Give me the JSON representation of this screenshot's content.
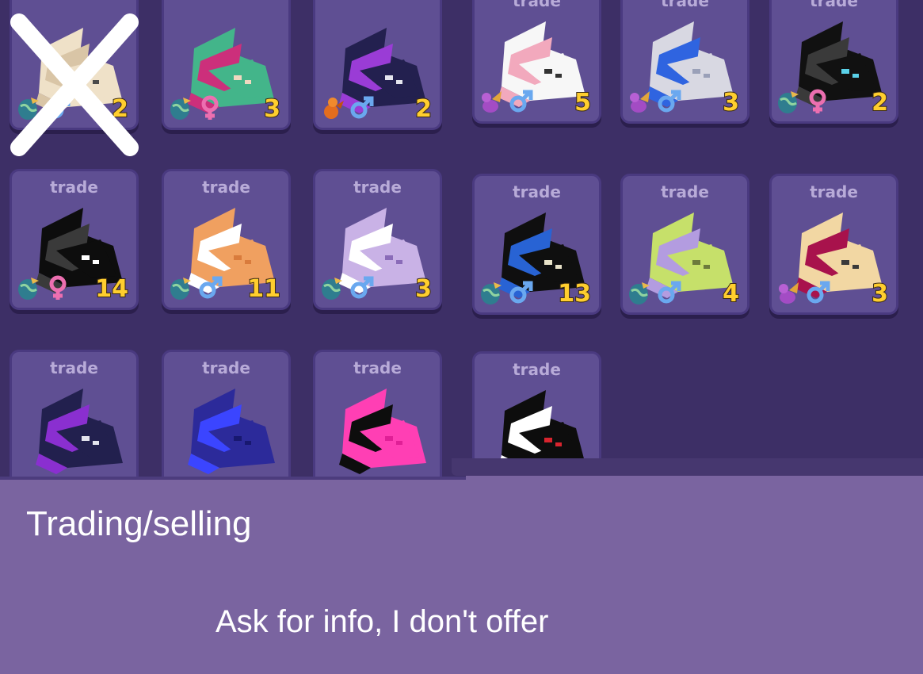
{
  "text": {
    "title": "Trading/selling",
    "subtitle": "Ask for info, I don't offer"
  },
  "colors": {
    "panel": "#3d2f66",
    "card": "#5f4f93",
    "card_border": "#4a3a80",
    "background": "#7a64a0",
    "level": "#ffce2e",
    "male": "#6aa8ef",
    "female": "#ec6fb0"
  },
  "left_cards": [
    {
      "label": "",
      "egg": "globe-egg-icon",
      "gender": "male",
      "gender_symbol": "♂",
      "level": "2",
      "colors": [
        "#efe1c8",
        "#d9c5a6",
        "#4a4a4a"
      ],
      "crossed": true
    },
    {
      "label": "",
      "egg": "globe-egg-icon",
      "gender": "female",
      "gender_symbol": "♀",
      "level": "3",
      "colors": [
        "#43b58a",
        "#cc2f7b",
        "#f0d8c0"
      ]
    },
    {
      "label": "",
      "egg": "orange-dragon-icon",
      "gender": "male",
      "gender_symbol": "♂",
      "level": "2",
      "colors": [
        "#23204f",
        "#9a3cd6",
        "#e6e6ef"
      ]
    },
    {
      "label": "trade",
      "egg": "globe-egg-icon",
      "gender": "female",
      "gender_symbol": "♀",
      "level": "14",
      "colors": [
        "#0d0d0d",
        "#3a3a3a",
        "#ffffff"
      ]
    },
    {
      "label": "trade",
      "egg": "globe-egg-icon",
      "gender": "male",
      "gender_symbol": "♂",
      "level": "11",
      "colors": [
        "#f0a060",
        "#ffffff",
        "#d97b3c"
      ]
    },
    {
      "label": "trade",
      "egg": "globe-egg-icon",
      "gender": "male",
      "gender_symbol": "♂",
      "level": "3",
      "colors": [
        "#c9b2e6",
        "#ffffff",
        "#8a6bb8"
      ]
    },
    {
      "label": "trade",
      "egg": "",
      "gender": "",
      "gender_symbol": "",
      "level": "",
      "colors": [
        "#22204e",
        "#8a2fd0",
        "#e4e4ee"
      ]
    },
    {
      "label": "trade",
      "egg": "",
      "gender": "",
      "gender_symbol": "",
      "level": "",
      "colors": [
        "#2c2a9a",
        "#3b45ff",
        "#181870"
      ]
    },
    {
      "label": "trade",
      "egg": "",
      "gender": "",
      "gender_symbol": "",
      "level": "",
      "colors": [
        "#ff3fb4",
        "#0d0d0d",
        "#e01f96"
      ]
    }
  ],
  "right_cards": [
    {
      "label": "trade",
      "egg": "purple-dragon-icon",
      "gender": "male",
      "gender_symbol": "♂",
      "level": "5",
      "colors": [
        "#f7f7f7",
        "#f2a9bd",
        "#333333"
      ]
    },
    {
      "label": "trade",
      "egg": "purple-dragon-icon",
      "gender": "male",
      "gender_symbol": "♂",
      "level": "3",
      "colors": [
        "#d8d8e2",
        "#2f64e0",
        "#9aa0b8"
      ]
    },
    {
      "label": "trade",
      "egg": "globe-egg-icon",
      "gender": "female",
      "gender_symbol": "♀",
      "level": "2",
      "colors": [
        "#111111",
        "#3a3a3a",
        "#5ad1e8"
      ]
    },
    {
      "label": "trade",
      "egg": "globe-egg-icon",
      "gender": "male",
      "gender_symbol": "♂",
      "level": "13",
      "colors": [
        "#0f0f0f",
        "#2863d4",
        "#e8e2c8"
      ]
    },
    {
      "label": "trade",
      "egg": "globe-egg-icon",
      "gender": "male",
      "gender_symbol": "♂",
      "level": "4",
      "colors": [
        "#c6e06a",
        "#b39ce0",
        "#6c7a3c"
      ]
    },
    {
      "label": "trade",
      "egg": "purple-dragon-icon",
      "gender": "male",
      "gender_symbol": "♂",
      "level": "3",
      "colors": [
        "#f2d7a3",
        "#a8124c",
        "#3a3a3a"
      ]
    },
    {
      "label": "trade",
      "egg": "",
      "gender": "",
      "gender_symbol": "",
      "level": "",
      "colors": [
        "#0d0d0d",
        "#ffffff",
        "#d8242e"
      ]
    }
  ]
}
